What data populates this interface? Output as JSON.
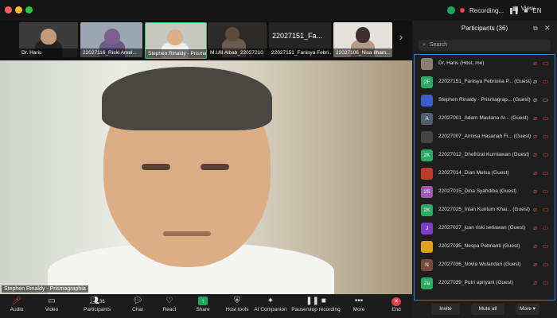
{
  "titlebar": {
    "recording_label": "Recording...",
    "language": "EN",
    "view_label": "View",
    "colors": {
      "close": "#ff5f57",
      "min": "#febc2e",
      "max": "#28c840"
    }
  },
  "strip": {
    "thumbs": [
      {
        "label": "Dr. Haris"
      },
      {
        "label": "22027116_Riski Amel..."
      },
      {
        "label": "Stephen Rinaldy - Prisma..."
      },
      {
        "label": "M.Ulil Albab_22027210"
      },
      {
        "label": "22027151_Fanisya Febri..."
      },
      {
        "label": "22027106_Nisa Ilham..."
      }
    ],
    "big_name": "22027151_Fa..."
  },
  "main": {
    "speaker_label": "Stephen Rinaldy - Prismagraphia"
  },
  "toolbar": {
    "items": [
      {
        "label": "Audio",
        "icon": "microphone-muted-icon"
      },
      {
        "label": "Video",
        "icon": "camera-icon"
      },
      {
        "label": "Participants",
        "icon": "participants-icon",
        "count": "36"
      },
      {
        "label": "Chat",
        "icon": "chat-icon"
      },
      {
        "label": "React",
        "icon": "heart-icon"
      },
      {
        "label": "Share",
        "icon": "share-icon"
      },
      {
        "label": "Host tools",
        "icon": "shield-icon"
      },
      {
        "label": "AI Companion",
        "icon": "sparkle-icon"
      },
      {
        "label": "Pause/stop recording",
        "icon": "pause-stop-icon"
      },
      {
        "label": "More",
        "icon": "more-icon"
      },
      {
        "label": "End",
        "icon": "end-icon"
      }
    ]
  },
  "panel": {
    "title": "Participants (36)",
    "search_placeholder": "Search",
    "participants": [
      {
        "name": "Dr. Haris (Host, me)",
        "initials": "",
        "color": "#777"
      },
      {
        "name": "22027151_Fanisya Febriona P... (Guest)",
        "initials": "2F",
        "color": "#2eaa67"
      },
      {
        "name": "Stephen Rinaldy - Prismagrap... (Guest)",
        "initials": "",
        "color": "#3a5fc8"
      },
      {
        "name": "22027001_Adam Maulana Ar... (Guest)",
        "initials": "A",
        "color": "#51606f"
      },
      {
        "name": "22027007_Annisa Hasanah Fi... (Guest)",
        "initials": "",
        "color": "#444"
      },
      {
        "name": "22027012_Dhefrizal Kurniawan (Guest)",
        "initials": "2K",
        "color": "#2eaa67"
      },
      {
        "name": "22027014_Dian Melsa (Guest)",
        "initials": "",
        "color": "#c0392b"
      },
      {
        "name": "22027015_Dina Syahdiba (Guest)",
        "initials": "2S",
        "color": "#9b59b6"
      },
      {
        "name": "22027025_Intan Kuntum Khai... (Guest)",
        "initials": "2K",
        "color": "#2eaa67"
      },
      {
        "name": "22027027_juan riski setiawan (Guest)",
        "initials": "J",
        "color": "#7e3fc7"
      },
      {
        "name": "22027035_Nespa Pebrianti (Guest)",
        "initials": "",
        "color": "#e0a21a"
      },
      {
        "name": "22027036_Novia Wulandari (Guest)",
        "initials": "N",
        "color": "#7a4a3a"
      },
      {
        "name": "22027039_Putri apriyani (Guest)",
        "initials": "2a",
        "color": "#2eaa67"
      }
    ],
    "buttons": {
      "invite": "Invite",
      "mute_all": "Mute all",
      "more": "More"
    }
  }
}
